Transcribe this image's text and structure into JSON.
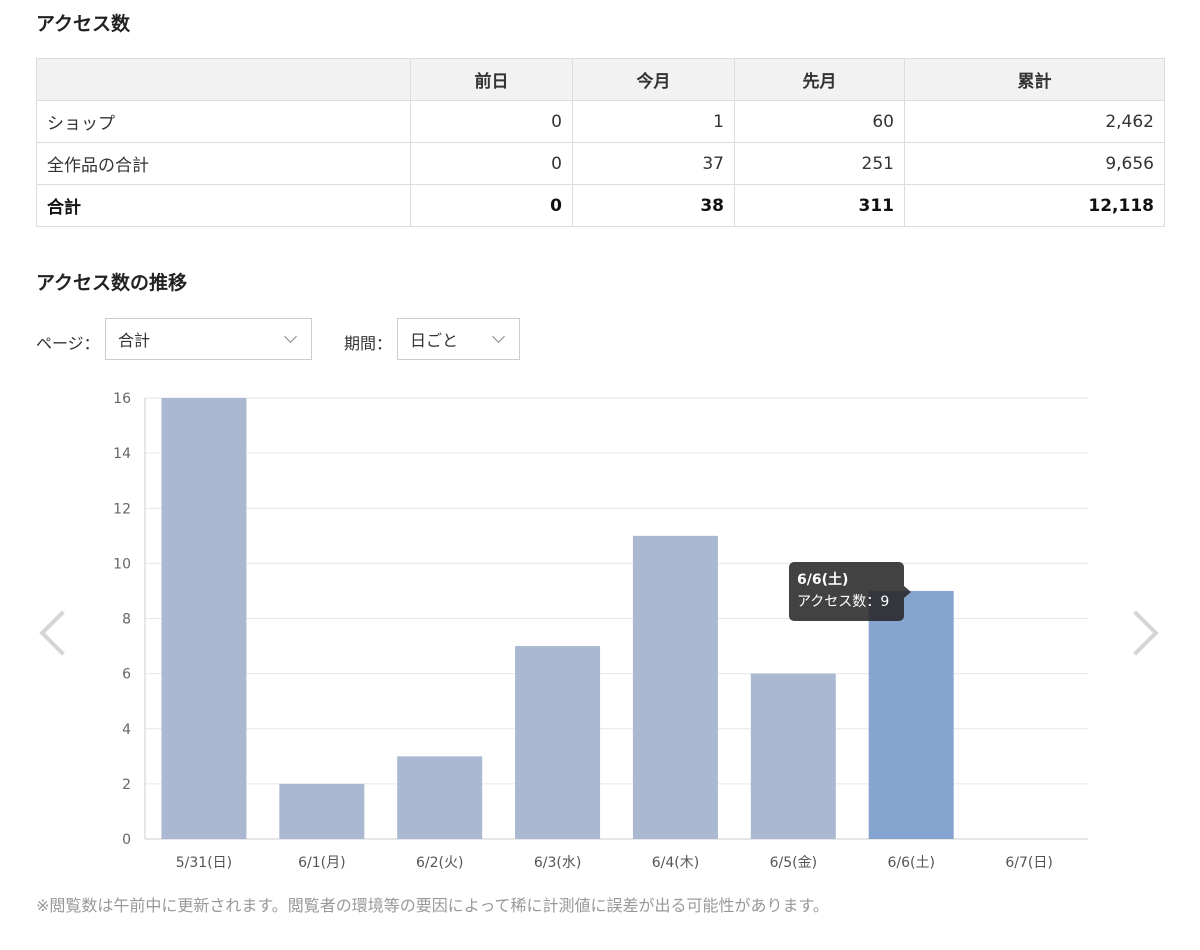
{
  "access": {
    "title": "アクセス数",
    "columns": [
      "",
      "前日",
      "今月",
      "先月",
      "累計"
    ],
    "rows": [
      {
        "label": "ショップ",
        "values": [
          "0",
          "1",
          "60",
          "2,462"
        ]
      },
      {
        "label": "全作品の合計",
        "values": [
          "0",
          "37",
          "251",
          "9,656"
        ]
      }
    ],
    "total": {
      "label": "合計",
      "values": [
        "0",
        "38",
        "311",
        "12,118"
      ]
    }
  },
  "trend": {
    "title": "アクセス数の推移",
    "page_filter": {
      "label": "ページ：",
      "value": "合計"
    },
    "period_filter": {
      "label": "期間：",
      "value": "日ごと"
    }
  },
  "tooltip": {
    "title": "6/6(土)",
    "series_label": "アクセス数",
    "value_text": "9"
  },
  "note": "※閲覧数は午前中に更新されます。閲覧者の環境等の要因によって稀に計測値に誤差が出る可能性があります。",
  "icons": {
    "prev": "chevron-left-icon",
    "next": "chevron-right-icon",
    "dropdown": "chevron-down-icon"
  },
  "colors": {
    "bar": "#aab9d1",
    "bar_highlight": "#86a4d0",
    "grid": "#e6e6e6",
    "tooltip_bg": "#333333"
  },
  "chart_data": {
    "type": "bar",
    "categories": [
      "5/31(日)",
      "6/1(月)",
      "6/2(火)",
      "6/3(水)",
      "6/4(木)",
      "6/5(金)",
      "6/6(土)",
      "6/7(日)"
    ],
    "values": [
      16,
      2,
      3,
      7,
      11,
      6,
      9,
      0
    ],
    "highlighted_index": 6,
    "ylim": [
      0,
      16
    ],
    "yticks": [
      0,
      2,
      4,
      6,
      8,
      10,
      12,
      14,
      16
    ],
    "grid": true,
    "legend": "none"
  }
}
